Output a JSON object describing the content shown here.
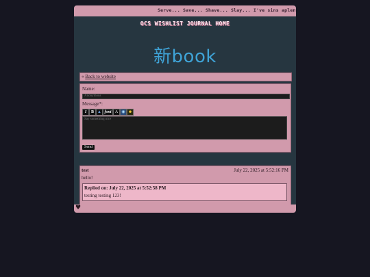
{
  "marquee": {
    "text": "Serve... Save... Shave... Slay... I've sins aplenty, aye, but regrets? None."
  },
  "header": {
    "home_link": "OCS WISHLIST JOURNAL HOME",
    "logo_text": "新book"
  },
  "nav": {
    "back_link": "Back to website",
    "back_prefix": "«"
  },
  "form": {
    "name_label": "Name:",
    "name_placeholder": "Anonymous",
    "message_label": "Message*:",
    "message_placeholder": "Say something nice",
    "toolbar": {
      "italic": "I",
      "bold": "B",
      "font": "font",
      "send_label": "Send"
    }
  },
  "entries": [
    {
      "author": "test",
      "date": "July 22, 2025 at 5:52:16 PM",
      "message": "hello!",
      "reply_header": "Replied on: July 22, 2025 at 5:52:58 PM",
      "reply_message": "testing testing 123!"
    }
  ],
  "colors": {
    "pink": "#d19aac",
    "panel": "#263640",
    "background": "#161621",
    "logo": "#3fa3d6"
  }
}
